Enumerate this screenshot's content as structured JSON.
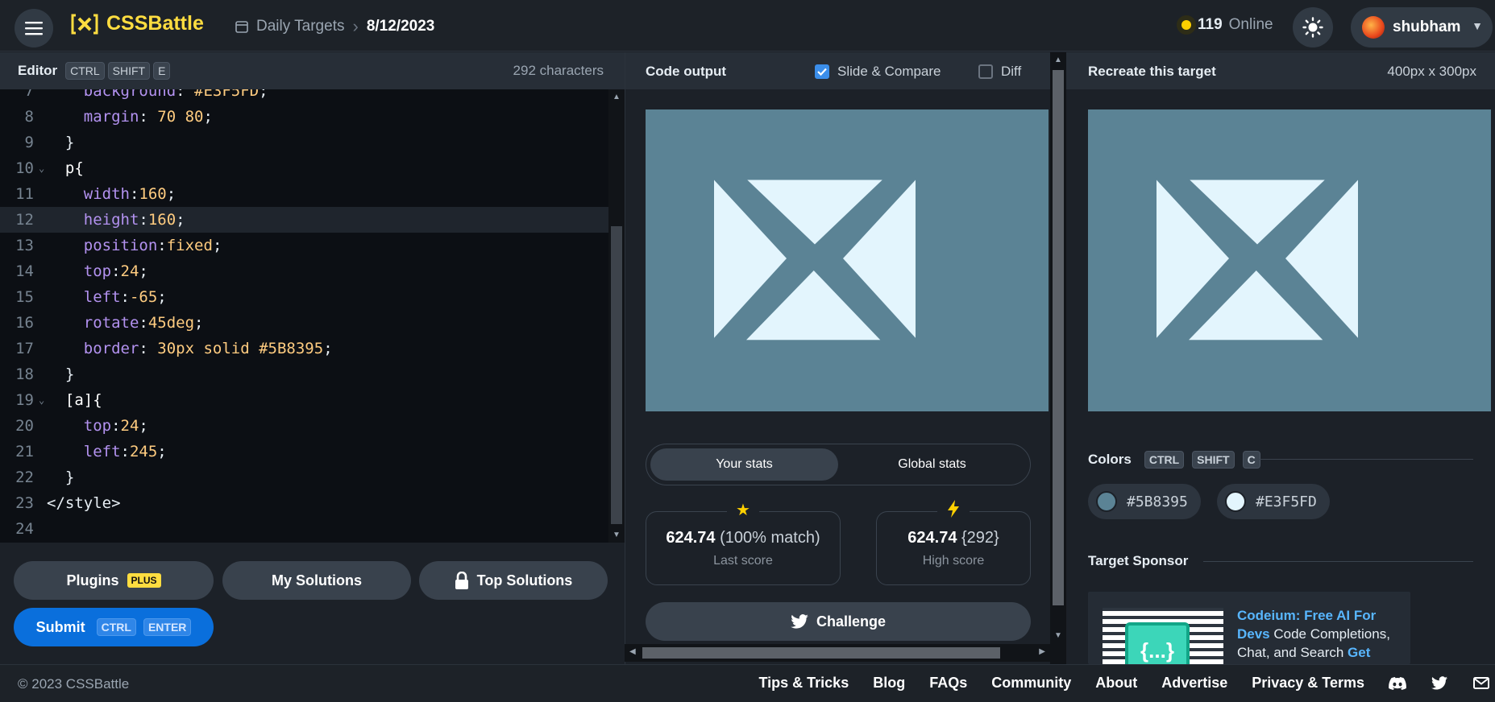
{
  "header": {
    "logo_text": "CSSBattle",
    "breadcrumb_section": "Daily Targets",
    "breadcrumb_date": "8/12/2023",
    "online_count": "119",
    "online_label": "Online",
    "username": "shubham"
  },
  "editor": {
    "title": "Editor",
    "shortcut": [
      "CTRL",
      "SHIFT",
      "E"
    ],
    "char_count": "292 characters",
    "lines": [
      {
        "num": "8",
        "text": "    margin: 70 80;"
      },
      {
        "num": "9",
        "text": "  }"
      },
      {
        "num": "10",
        "text": "  p{",
        "fold": true
      },
      {
        "num": "11",
        "text": "    width:160;"
      },
      {
        "num": "12",
        "text": "    height:160;",
        "active": true
      },
      {
        "num": "13",
        "text": "    position:fixed;"
      },
      {
        "num": "14",
        "text": "    top:24;"
      },
      {
        "num": "15",
        "text": "    left:-65;"
      },
      {
        "num": "16",
        "text": "    rotate:45deg;"
      },
      {
        "num": "17",
        "text": "    border: 30px solid #5B8395;"
      },
      {
        "num": "18",
        "text": "  }"
      },
      {
        "num": "19",
        "text": "  [a]{",
        "fold": true
      },
      {
        "num": "20",
        "text": "    top:24;"
      },
      {
        "num": "21",
        "text": "    left:245;"
      },
      {
        "num": "22",
        "text": "  }"
      },
      {
        "num": "23",
        "text": "</style>"
      },
      {
        "num": "24",
        "text": ""
      }
    ]
  },
  "buttons": {
    "plugins": "Plugins",
    "plus_badge": "PLUS",
    "my_solutions": "My Solutions",
    "top_solutions": "Top Solutions",
    "submit": "Submit",
    "submit_shortcut": [
      "CTRL",
      "ENTER"
    ]
  },
  "output": {
    "title": "Code output",
    "slide_compare": "Slide & Compare",
    "slide_compare_checked": true,
    "diff": "Diff",
    "diff_checked": false,
    "tab_your_stats": "Your stats",
    "tab_global_stats": "Global stats",
    "last_score_value": "624.74",
    "last_score_match": "(100% match)",
    "last_score_label": "Last score",
    "high_score_value": "624.74",
    "high_score_chars": "{292}",
    "high_score_label": "High score",
    "challenge": "Challenge"
  },
  "target": {
    "title": "Recreate this target",
    "size": "400px x 300px",
    "colors_title": "Colors",
    "colors_shortcut": [
      "CTRL",
      "SHIFT",
      "C"
    ],
    "colors": [
      {
        "hex": "#5B8395",
        "label": "#5B8395"
      },
      {
        "hex": "#E3F5FD",
        "label": "#E3F5FD"
      }
    ],
    "sponsor_title": "Target Sponsor",
    "sponsor_link": "Codeium: Free AI For Devs",
    "sponsor_text": " Code Completions, Chat, and Search ",
    "sponsor_get": "Get",
    "sponsor_img_text": "{...}"
  },
  "palette": {
    "bg": "#5B8395",
    "fg": "#E3F5FD",
    "accent": "#ffdd40",
    "brand_blue": "#0a6fdc"
  },
  "footer": {
    "copyright": "© 2023 CSSBattle",
    "links": [
      "Tips & Tricks",
      "Blog",
      "FAQs",
      "Community",
      "About",
      "Advertise",
      "Privacy & Terms"
    ],
    "icons": [
      "discord-icon",
      "twitter-icon",
      "mail-icon"
    ]
  }
}
